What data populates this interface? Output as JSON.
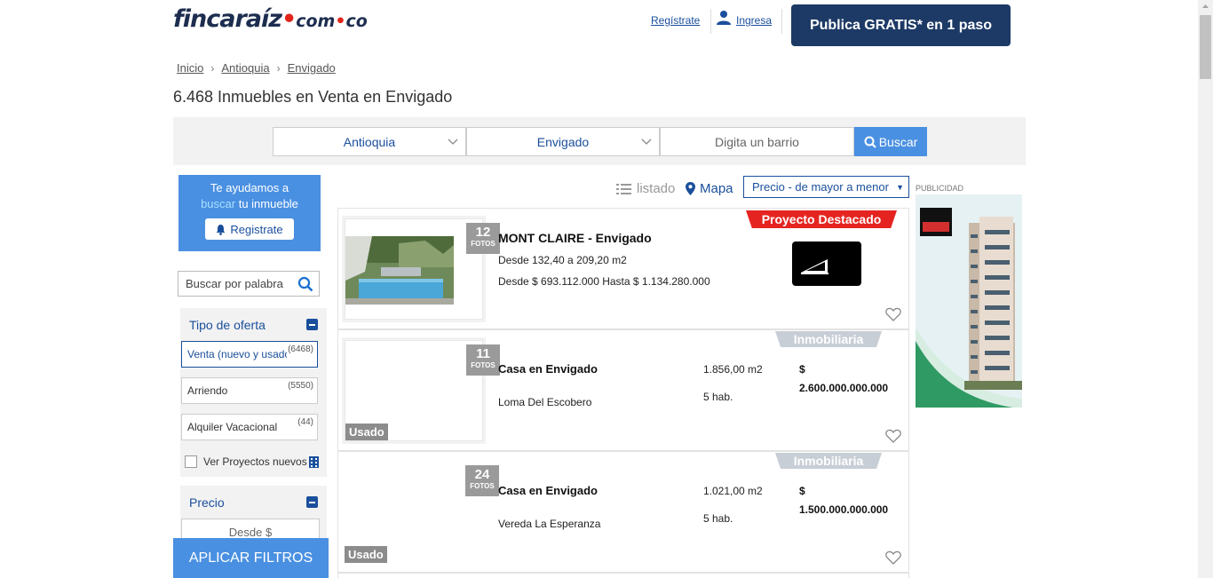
{
  "header": {
    "logo_main": "fincaraíz",
    "logo_com": "com",
    "logo_co": "co",
    "register_link": "Regístrate",
    "login_link": "Ingresa",
    "publish_button": "Publica GRATIS* en 1 paso"
  },
  "breadcrumb": [
    "Inicio",
    "Antioquia",
    "Envigado"
  ],
  "page_title": "6.468 Inmuebles en Venta en Envigado",
  "search": {
    "department": "Antioquia",
    "city": "Envigado",
    "neighborhood_placeholder": "Digita un barrio",
    "button": "Buscar"
  },
  "sidebar": {
    "help_line1": "Te ayudamos a",
    "help_highlight": "buscar",
    "help_rest": " tu inmueble",
    "help_button": "Registrate",
    "keyword_placeholder": "Buscar por palabra",
    "offer_title": "Tipo de oferta",
    "offer_options": [
      {
        "label": "Venta (nuevo y usado)",
        "count": "(6468)"
      },
      {
        "label": "Arriendo",
        "count": "(5550)"
      },
      {
        "label": "Alquiler Vacacional",
        "count": "(44)"
      }
    ],
    "projects_checkbox": "Ver Proyectos nuevos",
    "price_title": "Precio",
    "price_from_placeholder": "Desde $",
    "apply_button": "APLICAR FILTROS"
  },
  "toolbar": {
    "list_view": "listado",
    "map_view": "Mapa",
    "sort": "Precio - de mayor a menor"
  },
  "listings": [
    {
      "photos": "12",
      "photos_label": "FOTOS",
      "ribbon": "Proyecto Destacado",
      "title": "MONT CLAIRE - Envigado",
      "area": "Desde 132,40 a 209,20 m2",
      "price": "Desde $ 693.112.000 Hasta $ 1.134.280.000"
    },
    {
      "photos": "11",
      "photos_label": "FOTOS",
      "ribbon": "Inmobiliaria",
      "badge": "Usado",
      "title": "Casa en Envigado",
      "location": "Loma Del Escobero",
      "area": "1.856,00 m2",
      "rooms": "5 hab.",
      "currency": "$",
      "price": "2.600.000.000.000"
    },
    {
      "photos": "24",
      "photos_label": "FOTOS",
      "ribbon": "Inmobiliaria",
      "badge": "Usado",
      "title": "Casa en Envigado",
      "location": "Vereda La Esperanza",
      "area": "1.021,00 m2",
      "rooms": "5 hab.",
      "currency": "$",
      "price": "1.500.000.000.000"
    }
  ],
  "ad_label": "PUBLICIDAD",
  "colors": {
    "brand_navy": "#1d3a66",
    "accent_blue": "#4a90e2",
    "ribbon_red": "#e52421"
  }
}
